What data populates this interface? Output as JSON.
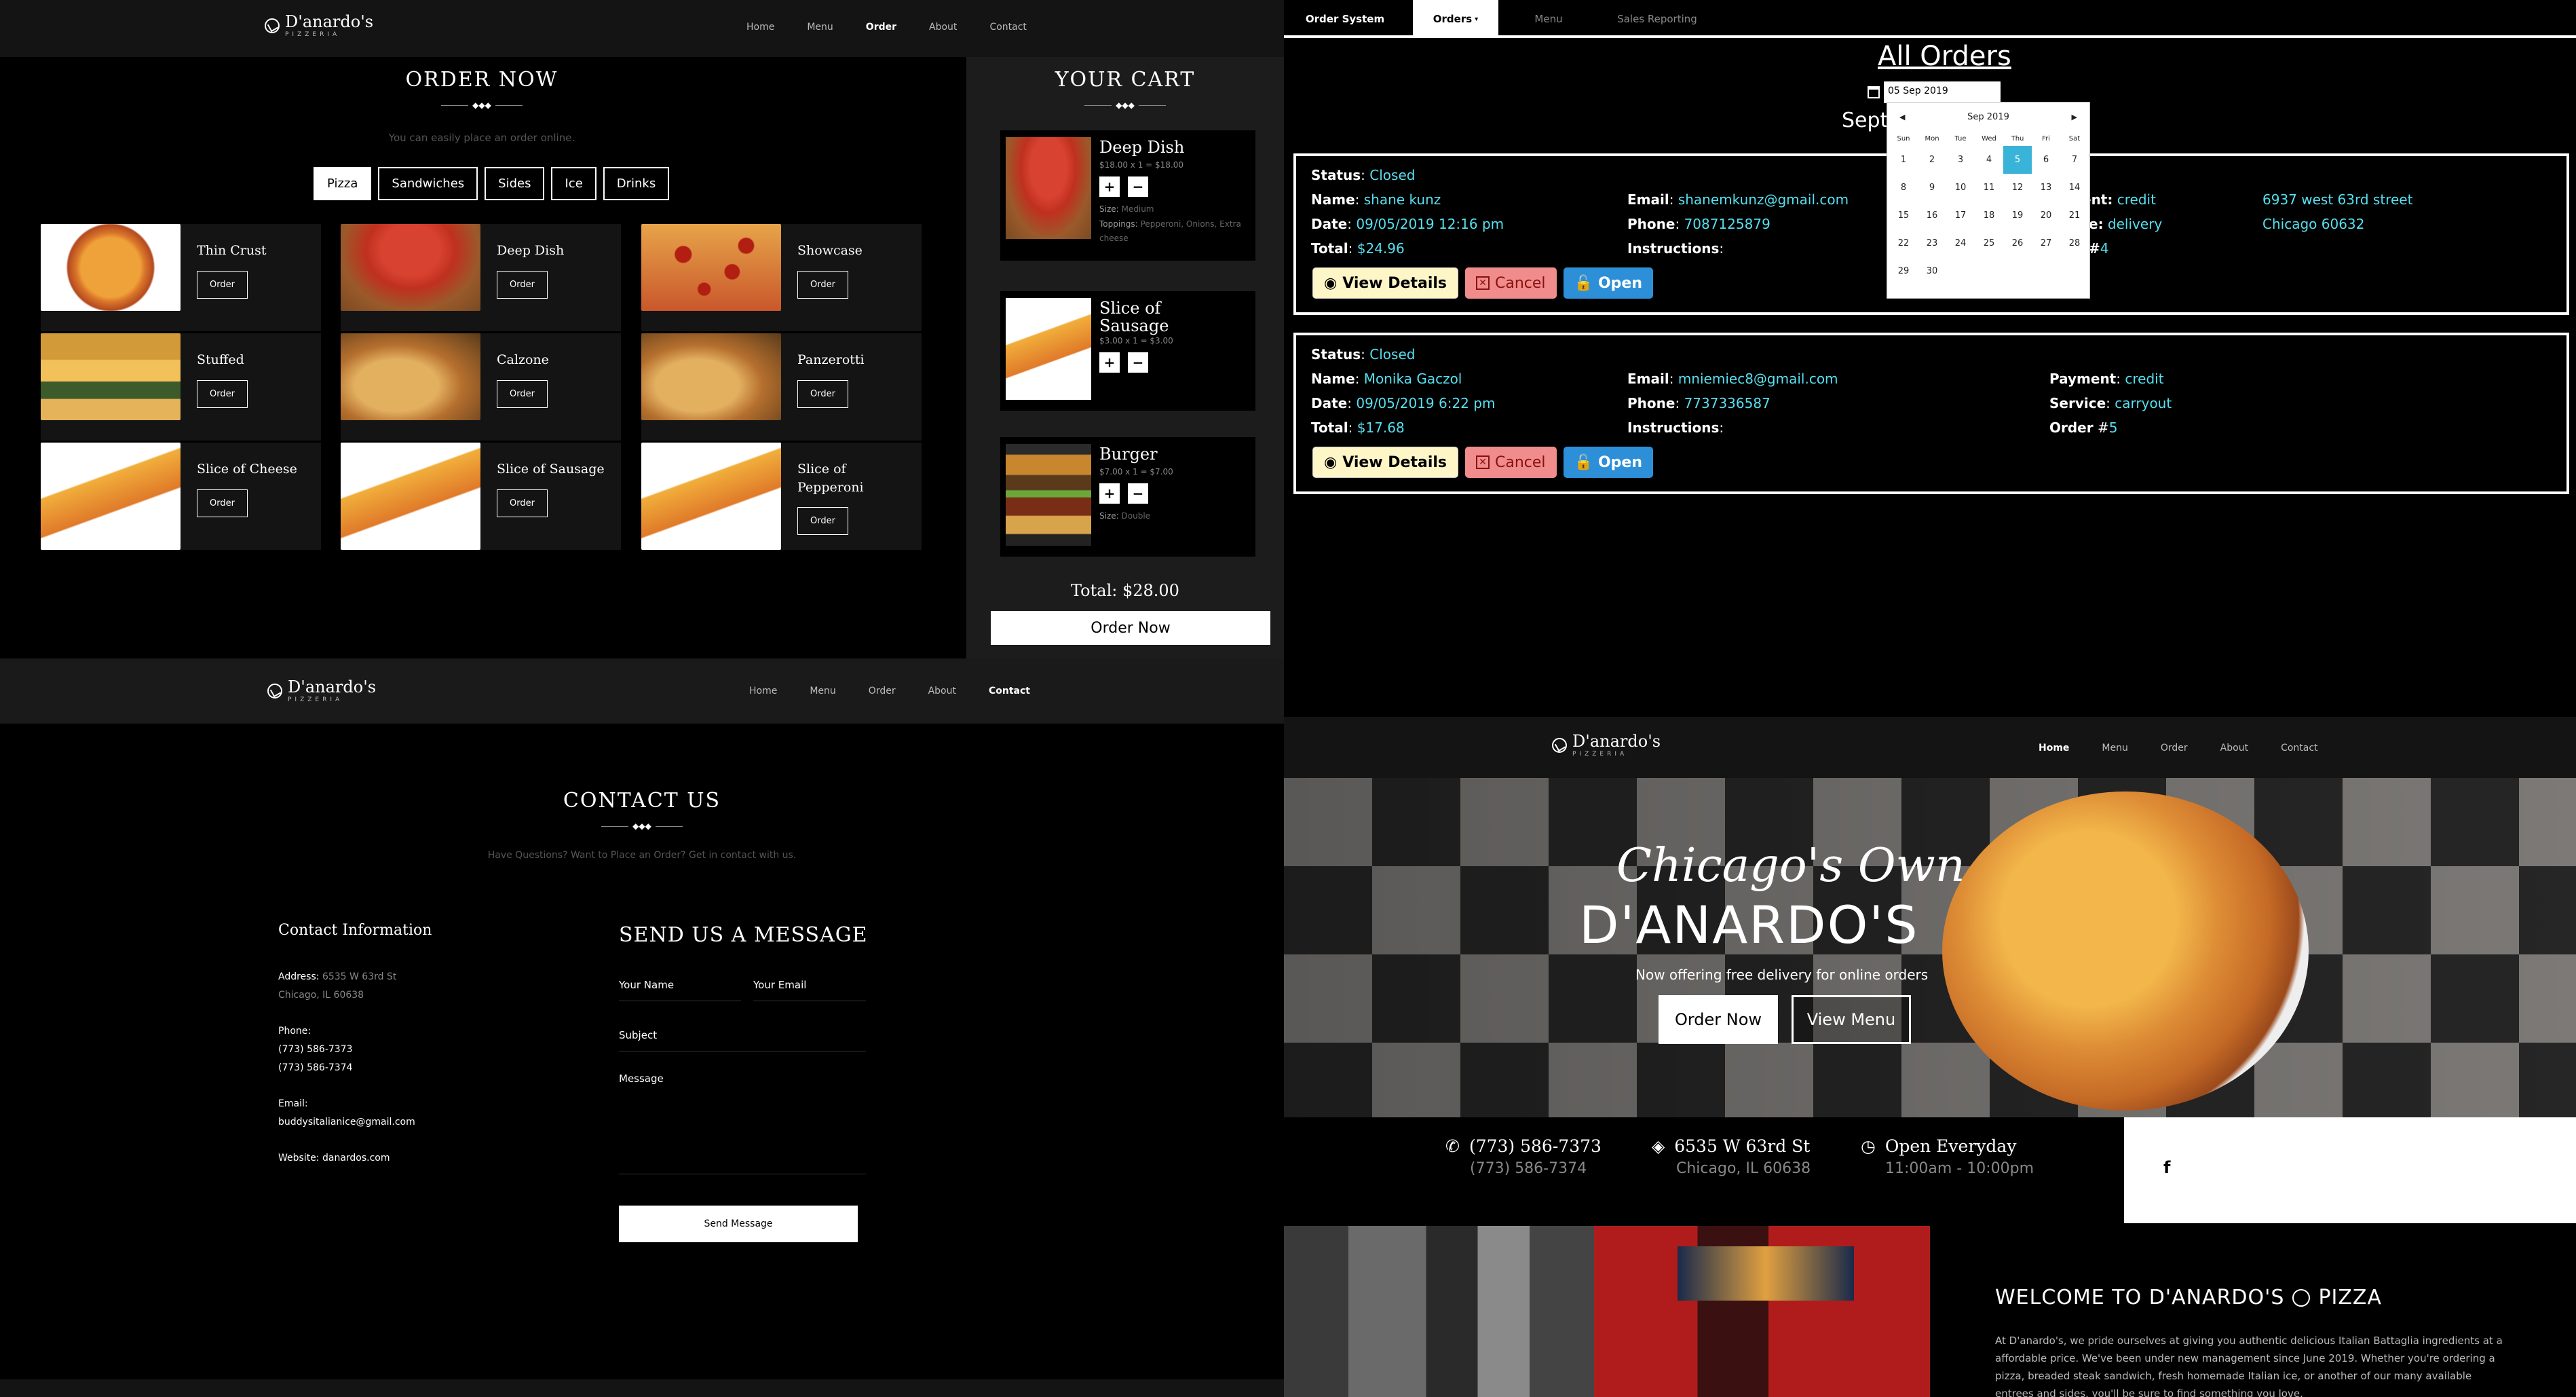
{
  "site": {
    "logo_name": "D'anardo's",
    "logo_sub": "PIZZERIA",
    "nav": [
      "Home",
      "Menu",
      "Order",
      "About",
      "Contact"
    ]
  },
  "order_page": {
    "title": "ORDER NOW",
    "subtitle": "You can easily place an order online.",
    "categories": [
      "Pizza",
      "Sandwiches",
      "Sides",
      "Ice",
      "Drinks"
    ],
    "items": [
      {
        "name": "Thin Crust",
        "btn": "Order"
      },
      {
        "name": "Deep Dish",
        "btn": "Order"
      },
      {
        "name": "Showcase",
        "btn": "Order"
      },
      {
        "name": "Stuffed",
        "btn": "Order"
      },
      {
        "name": "Calzone",
        "btn": "Order"
      },
      {
        "name": "Panzerotti",
        "btn": "Order"
      },
      {
        "name": "Slice of Cheese",
        "btn": "Order"
      },
      {
        "name": "Slice of Sausage",
        "btn": "Order"
      },
      {
        "name": "Slice of Pepperoni",
        "btn": "Order"
      }
    ],
    "cart": {
      "title": "YOUR CART",
      "items": [
        {
          "name": "Deep Dish",
          "price": "$18.00 x 1 = $18.00",
          "extra1_label": "Size:",
          "extra1": "Medium",
          "extra2_label": "Toppings:",
          "extra2": "Pepperoni, Onions, Extra cheese"
        },
        {
          "name": "Slice of Sausage",
          "price": "$3.00 x 1 = $3.00"
        },
        {
          "name": "Burger",
          "price": "$7.00 x 1 = $7.00",
          "extra1_label": "Size:",
          "extra1": "Double"
        }
      ],
      "plus": "+",
      "minus": "−",
      "total": "Total: $28.00",
      "order_btn": "Order Now"
    }
  },
  "admin": {
    "tabs": [
      "Order System",
      "Orders",
      "Menu",
      "Sales Reporting"
    ],
    "orders_caret": "▾",
    "title": "All Orders",
    "date_value": "05 Sep 2019",
    "partial_heading": "Sept",
    "labels": {
      "status": "Status",
      "name": "Name",
      "date": "Date",
      "total": "Total",
      "email": "Email",
      "phone": "Phone",
      "instructions": "Instructions",
      "payment": "Payment",
      "service": "Service",
      "order": "Order"
    },
    "partial_labels": {
      "payment": "ent:",
      "service": "e:",
      "order": "#"
    },
    "orders": [
      {
        "status": "Closed",
        "name": "shane kunz",
        "date": "09/05/2019 12:16 pm",
        "total": "$24.96",
        "email": "shanemkunz@gmail.com",
        "phone": "7087125879",
        "payment": "credit",
        "service": "delivery",
        "order": "4",
        "address1": "6937 west 63rd street",
        "address2": "Chicago 60632"
      },
      {
        "status": "Closed",
        "name": "Monika Gaczol",
        "date": "09/05/2019 6:22 pm",
        "total": "$17.68",
        "email": "mniemiec8@gmail.com",
        "phone": "7737336587",
        "payment": "credit",
        "service": "carryout",
        "order": "5"
      }
    ],
    "buttons": {
      "details": "View Details",
      "cancel": "Cancel",
      "open": "Open"
    },
    "calendar": {
      "month": "Sep 2019",
      "prev": "◀",
      "next": "▶",
      "days": [
        "Sun",
        "Mon",
        "Tue",
        "Wed",
        "Thu",
        "Fri",
        "Sat"
      ],
      "dates": [
        "1",
        "2",
        "3",
        "4",
        "5",
        "6",
        "7",
        "8",
        "9",
        "10",
        "11",
        "12",
        "13",
        "14",
        "15",
        "16",
        "17",
        "18",
        "19",
        "20",
        "21",
        "22",
        "23",
        "24",
        "25",
        "26",
        "27",
        "28",
        "29",
        "30"
      ],
      "selected": "5"
    }
  },
  "contact_page": {
    "title": "CONTACT US",
    "subtitle": "Have Questions? Want to Place an Order? Get in contact with us.",
    "info_title": "Contact Information",
    "address_label": "Address:",
    "address1": "6535 W 63rd St",
    "address2": "Chicago, IL 60638",
    "phone_label": "Phone:",
    "phone1": "(773) 586-7373",
    "phone2": "(773) 586-7374",
    "email_label": "Email:",
    "email": "buddysitalianice@gmail.com",
    "website_label": "Website:",
    "website": "danardos.com",
    "form_title": "SEND US A MESSAGE",
    "f_name": "Your Name",
    "f_email": "Your Email",
    "f_subject": "Subject",
    "f_message": "Message",
    "send": "Send Message"
  },
  "home_page": {
    "script_line": "Chicago's Own",
    "brand": "D'ANARDO'S",
    "tagline": "Now offering free delivery for online orders",
    "btn_order": "Order Now",
    "btn_menu": "View Menu",
    "phone1": "(773) 586-7373",
    "phone2": "(773) 586-7374",
    "addr1": "6535 W 63rd St",
    "addr2": "Chicago, IL 60638",
    "hours1": "Open Everyday",
    "hours2": "11:00am - 10:00pm",
    "facebook": "f",
    "welcome_title": "WELCOME TO D'ANARDO'S",
    "welcome_title_end": "PIZZA",
    "welcome_text": "At D'anardo's, we pride ourselves at giving you authentic delicious Italian Battaglia ingredients at a affordable price. We've been under new management since June 2019. Whether you're ordering a pizza, breaded steak sandwich, fresh homemade Italian ice, or another of our many available entrees and sides, you'll be sure to find something you love."
  },
  "colors": {
    "link": "#56e0f0",
    "details_btn": "#fff6c8",
    "cancel_btn": "#f08c8c",
    "open_btn": "#2d8fd8",
    "cal_selected": "#3ab3d8"
  }
}
